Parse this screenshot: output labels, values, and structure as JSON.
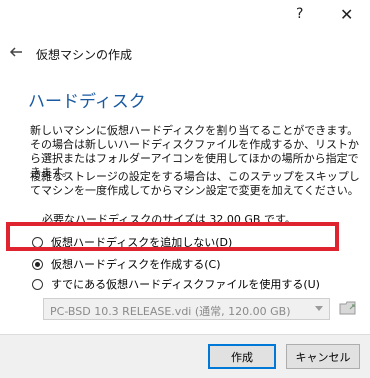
{
  "titlebar": {
    "help_label": "?",
    "close_label": "✕"
  },
  "dialog": {
    "title": "仮想マシンの作成"
  },
  "section": {
    "title": "ハードディスク"
  },
  "paragraphs": {
    "p1": "新しいマシンに仮想ハードディスクを割り当てることができます。その場合は新しいハードディスクファイルを作成するか、リストから選択またはフォルダーアイコンを使用してほかの場所から指定できます。",
    "p2": "複雑なストレージの設定をする場合は、このステップをスキップしてマシンを一度作成してからマシン設定で変更を加えてください。",
    "required_size": "必要なハードディスクのサイズは 32.00 GB です。"
  },
  "options": [
    {
      "label": "仮想ハードディスクを追加しない(D)",
      "selected": false
    },
    {
      "label": "仮想ハードディスクを作成する(C)",
      "selected": true
    },
    {
      "label": "すでにある仮想ハードディスクファイルを使用する(U)",
      "selected": false
    }
  ],
  "disk_combo": {
    "value": "PC-BSD 10.3 RELEASE.vdi (通常, 120.00 GB)"
  },
  "buttons": {
    "create": "作成",
    "cancel": "キャンセル"
  },
  "colors": {
    "accent": "#0078d7",
    "highlight": "#e0242f",
    "section_title": "#1a5aa0"
  },
  "icons": {
    "back": "back-arrow-icon",
    "folder": "folder-icon",
    "dropdown": "chevron-down-icon"
  }
}
